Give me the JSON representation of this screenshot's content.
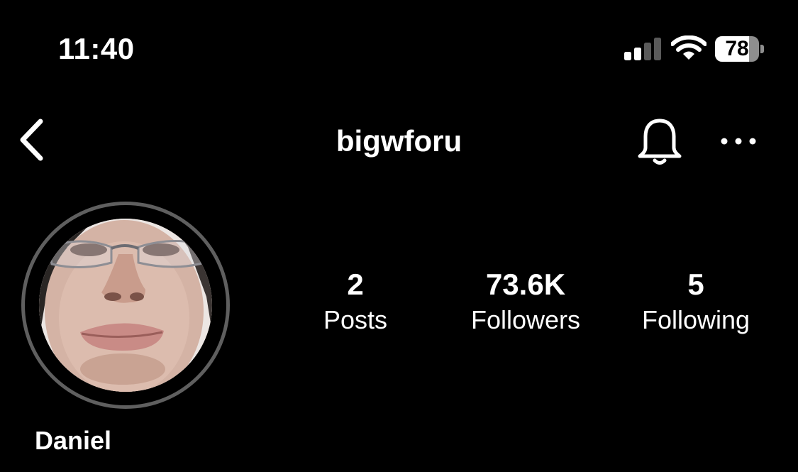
{
  "status_bar": {
    "time": "11:40",
    "signal_bars_active": 2,
    "signal_bars_total": 4,
    "wifi_icon": "wifi-icon",
    "battery_level": "78",
    "battery_fraction": 0.78
  },
  "header": {
    "back_icon": "chevron-left-icon",
    "username": "bigwforu",
    "notifications_icon": "bell-icon",
    "more_icon": "ellipsis-icon"
  },
  "profile": {
    "avatar": "profile-photo",
    "display_name": "Daniel",
    "stats": [
      {
        "value": "2",
        "label": "Posts"
      },
      {
        "value": "73.6K",
        "label": "Followers"
      },
      {
        "value": "5",
        "label": "Following"
      }
    ]
  },
  "colors": {
    "background": "#000000",
    "text": "#ffffff",
    "avatar_ring": "#5f5f5f",
    "inactive_signal": "#5a5a5a"
  }
}
